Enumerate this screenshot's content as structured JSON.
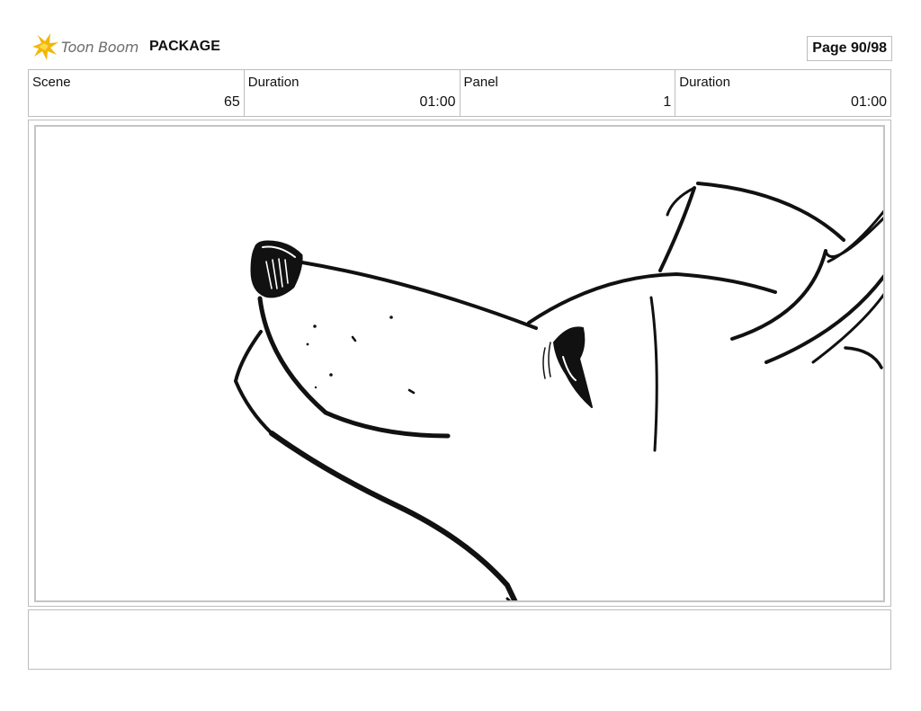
{
  "header": {
    "brand": "Toon Boom",
    "project": "PACKAGE",
    "page_label": "Page 90/98",
    "accent_color": "#f2b705"
  },
  "info": [
    {
      "label": "Scene",
      "value": "65"
    },
    {
      "label": "Duration",
      "value": "01:00"
    },
    {
      "label": "Panel",
      "value": "1"
    },
    {
      "label": "Duration",
      "value": "01:00"
    }
  ],
  "panel": {
    "drawing": "storyboard-sketch-dog-head-profile",
    "line_color": "#111111"
  },
  "notes": {
    "text": ""
  }
}
